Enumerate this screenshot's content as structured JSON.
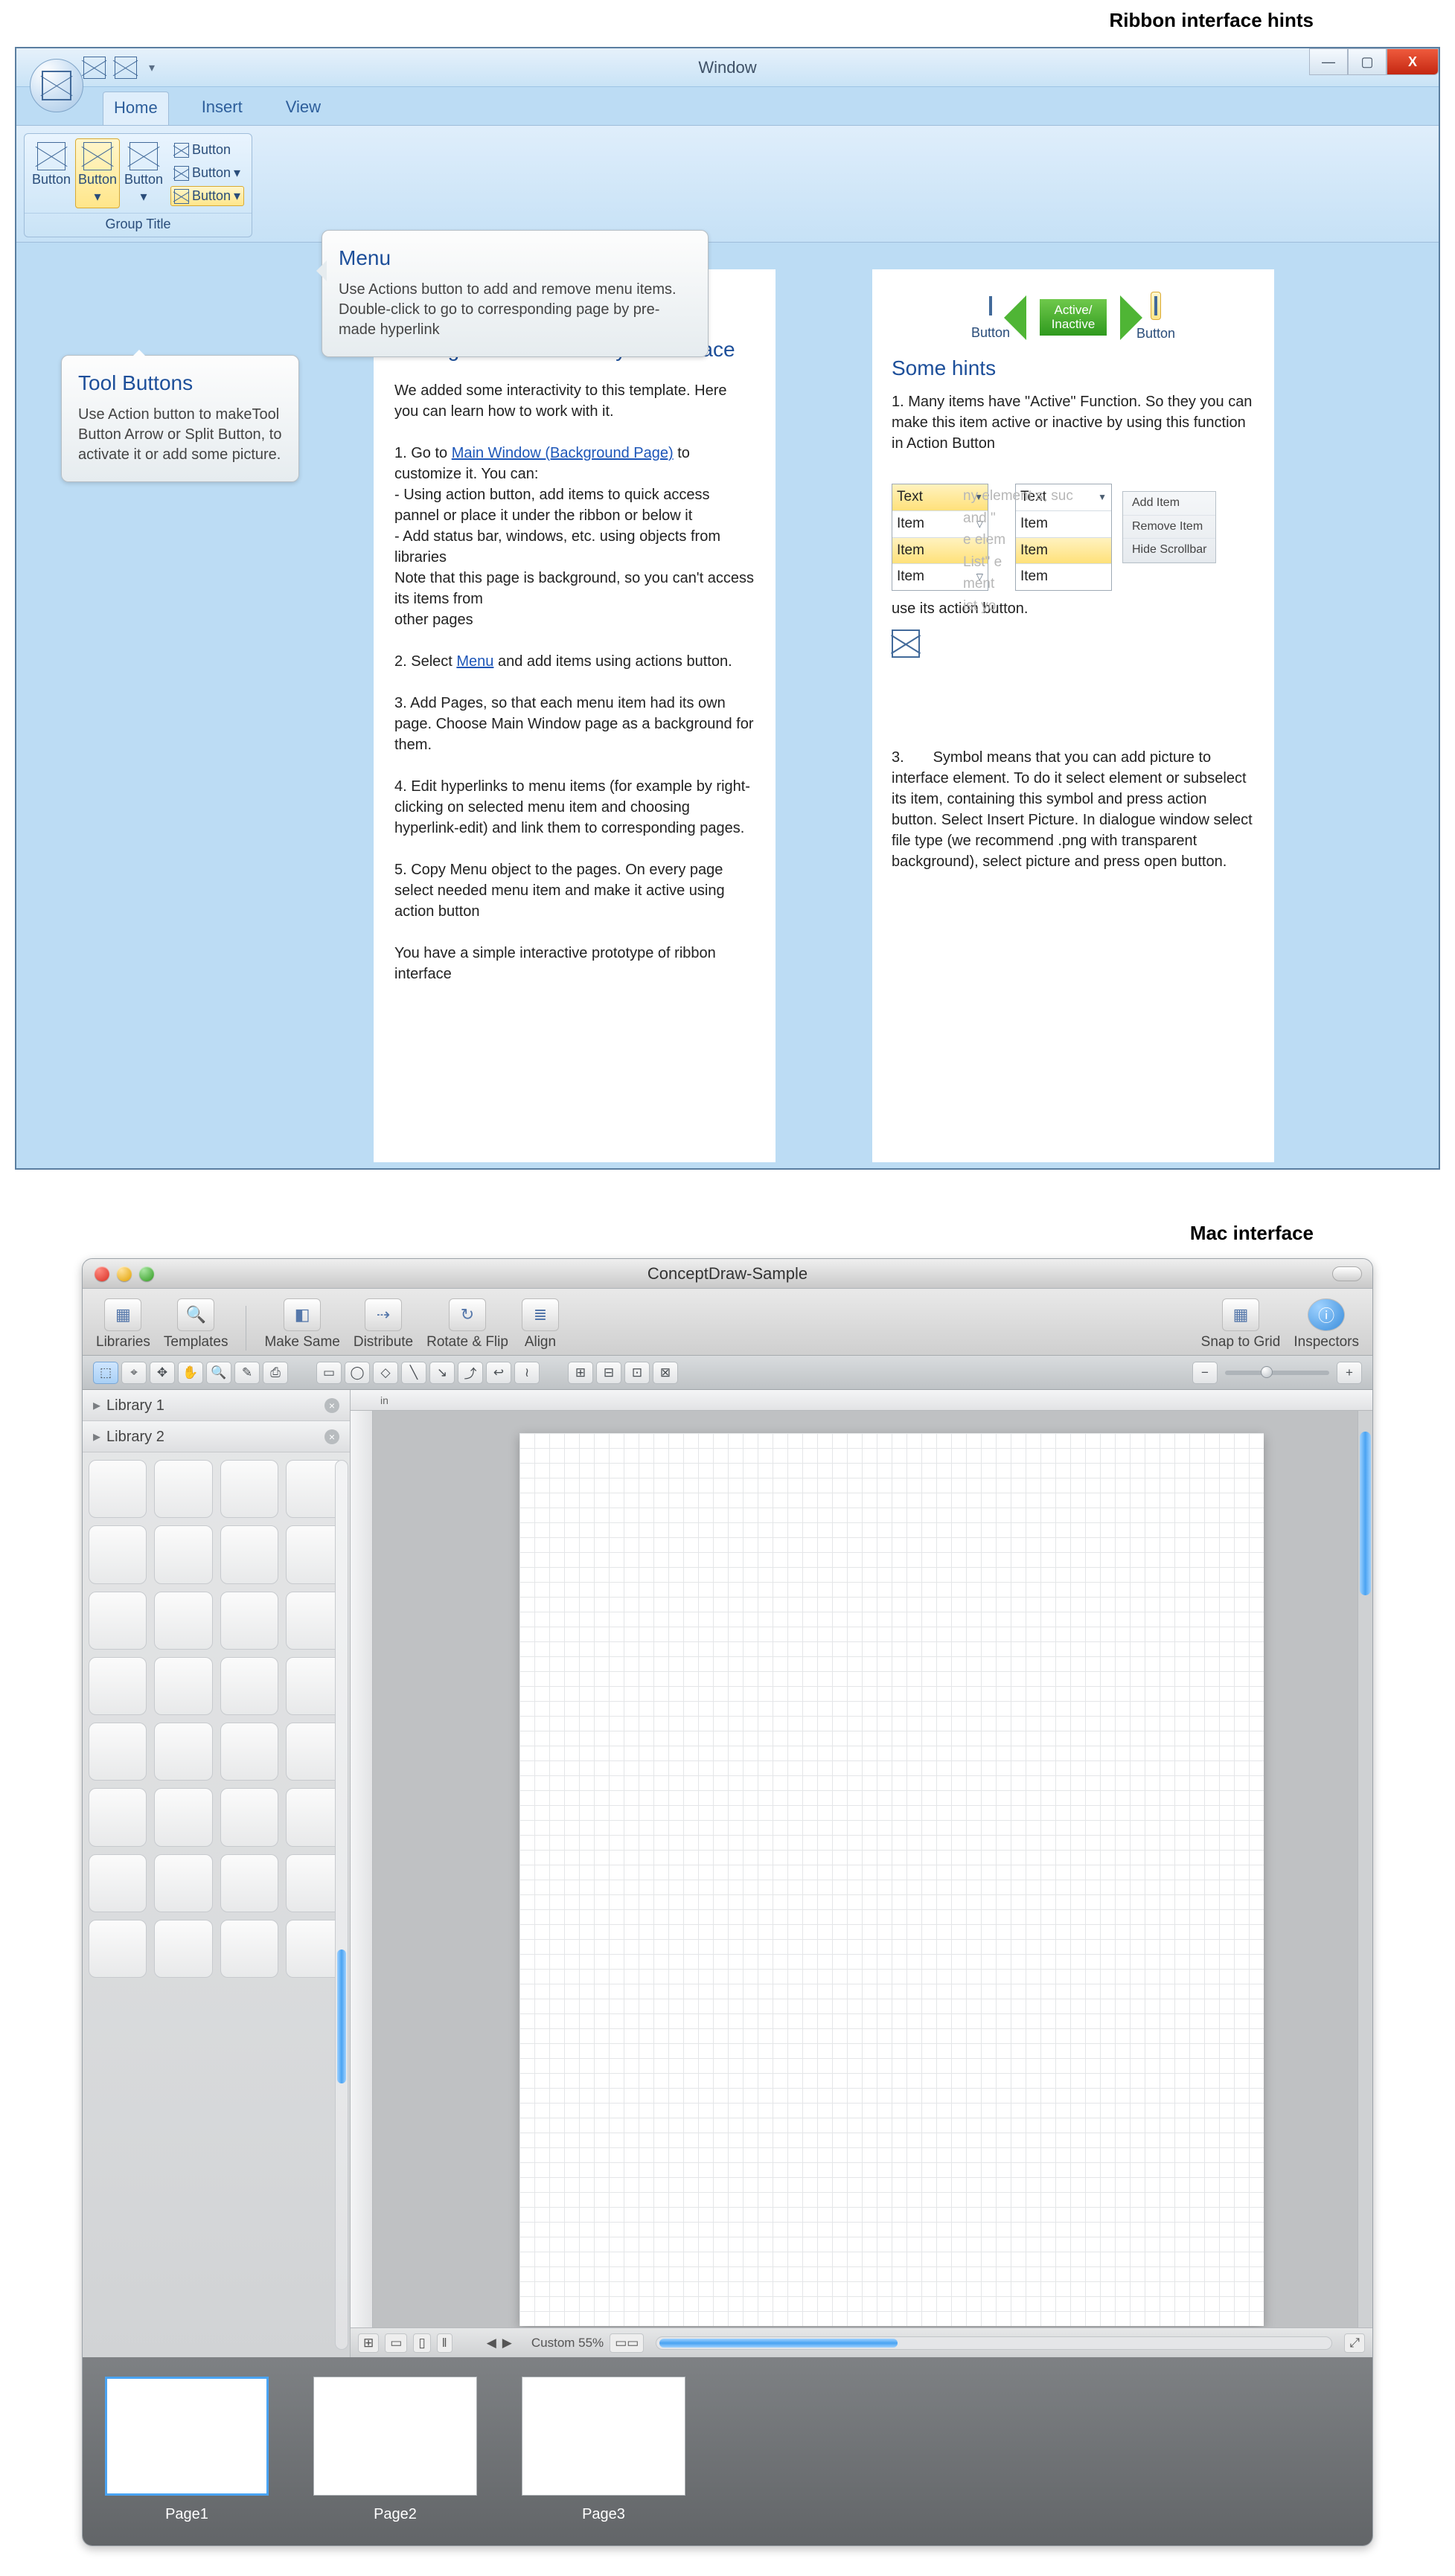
{
  "titles": {
    "ribbon_section": "Ribbon interface hints",
    "mac_section": "Mac interface"
  },
  "ribbon": {
    "window_title": "Window",
    "qat_caret": "▾",
    "win_controls": {
      "min": "—",
      "max": "▢",
      "close": "X"
    },
    "tabs": [
      "Home",
      "Insert",
      "View"
    ],
    "group_title": "Group Title",
    "big_buttons": [
      {
        "label": "Button",
        "caret": ""
      },
      {
        "label": "Button",
        "caret": "▾",
        "active": true
      },
      {
        "label": "Button",
        "caret": "▾"
      }
    ],
    "mini_buttons": [
      {
        "label": "Button",
        "caret": ""
      },
      {
        "label": "Button",
        "caret": "▾"
      },
      {
        "label": "Button",
        "caret": "▾",
        "active": true
      }
    ],
    "callout_menu": {
      "title": "Menu",
      "body": "Use Actions button to add and remove menu items. Double-click to go to corresponding page by pre-made hyperlink"
    },
    "callout_tool": {
      "title": "Tool Buttons",
      "body": "Use Action button to makeTool Button Arrow or Split Button, to activate it or add some picture."
    }
  },
  "doc": {
    "heading": "Adding some interactivity to interface",
    "p_intro": "We added some interactivity to this template. Here you can learn how to work with it.",
    "p1_a": "1. Go to ",
    "p1_link": "Main Window (Background Page)",
    "p1_b": "  to customize it. You can:",
    "p1_l1": "- Using action button, add items to quick access pannel or place it under the ribbon or below it",
    "p1_l2": "- Add  status bar, windows, etc. using objects from libraries",
    "p1_note": "Note that this page is background, so you can't access its items from",
    "p1_note2": "other pages",
    "p2_a": "2. Select ",
    "p2_link": "Menu",
    "p2_b": " and add items using actions button.",
    "p3": "3. Add Pages, so that each menu item had its own page. Choose Main Window page as a background for them.",
    "p4": "4. Edit hyperlinks to menu items (for example by right-clicking on selected menu item and choosing hyperlink-edit) and link them to corresponding pages.",
    "p5": "5. Copy Menu object to the pages. On every page select needed menu item and make it active using action button",
    "p_out": "You have a simple interactive prototype of ribbon interface"
  },
  "hints": {
    "heading": "Some hints",
    "btn_label": "Button",
    "arrow_label": "Active/\nInactive",
    "p1": "1. Many items have \"Active\" Function. So they you can make this item active or inactive by using this function in Action Button",
    "ghost": "ny element   s, suc\n                and \"\n              e elem\n  List\" e\n     ment\n      ist yo",
    "combo": {
      "header": "Text",
      "items": [
        "Item",
        "Item",
        "Item"
      ],
      "sel_index": 1
    },
    "ctx": [
      "Add Item",
      "Remove Item",
      "Hide Scrollbar"
    ],
    "p2_tail": "use its action button.",
    "p3_a": "3.",
    "p3_b": "Symbol means that you can add picture to interface element. To do it select element or subselect its item, containing this symbol and press action button. Select Insert Picture. In dialogue window select file type (we recommend .png with transparent background), select picture and press open button."
  },
  "mac": {
    "window_title": "ConceptDraw-Sample",
    "toolbar": [
      {
        "label": "Libraries",
        "icon": "▦"
      },
      {
        "label": "Templates",
        "icon": "🔍"
      },
      {
        "label": "Make Same",
        "icon": "◧"
      },
      {
        "label": "Distribute",
        "icon": "⇢"
      },
      {
        "label": "Rotate & Flip",
        "icon": "↻"
      },
      {
        "label": "Align",
        "icon": "≣"
      }
    ],
    "toolbar_right": [
      {
        "label": "Snap to Grid",
        "icon": "▦"
      },
      {
        "label": "Inspectors",
        "icon": "ⓘ"
      }
    ],
    "strip_icons_left": [
      "⬚",
      "⌖",
      "✥",
      "✋",
      "🔍",
      "✎",
      "⎙"
    ],
    "strip_icons_mid": [
      "▭",
      "◯",
      "◇",
      "╲",
      "↘",
      "⤴",
      "↩",
      "≀"
    ],
    "strip_icons_mid2": [
      "⊞",
      "⊟",
      "⊡",
      "⊠"
    ],
    "ruler_unit": "in",
    "libs": [
      "Library 1",
      "Library 2"
    ],
    "status": {
      "zoom_label": "Custom 55%",
      "nav": [
        "◀",
        "▶"
      ]
    },
    "pages": [
      "Page1",
      "Page2",
      "Page3"
    ]
  }
}
